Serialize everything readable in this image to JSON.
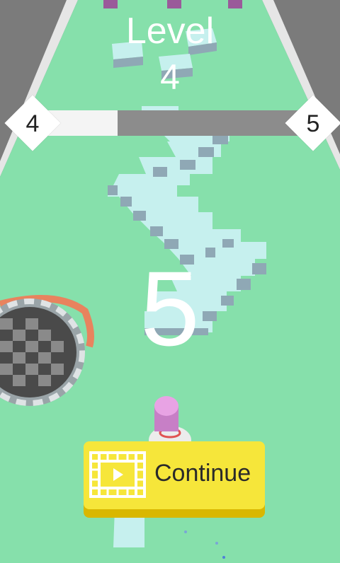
{
  "hud": {
    "level_label": "Level",
    "level_number": "4",
    "progress_from": "4",
    "progress_to": "5",
    "progress_fraction": 0.31,
    "countdown": "5"
  },
  "continue_button": {
    "label": "Continue",
    "icon": "video-ad-icon"
  },
  "colors": {
    "ground": "#86e0ab",
    "track_edge": "#ffffff",
    "side_floor": "#7a7a7a",
    "stairs_top": "#c6f0ee",
    "stairs_side": "#8fa8b5",
    "player_top": "#e8a3e4",
    "button": "#f6e63a",
    "hole_rim": "#e8835e"
  }
}
